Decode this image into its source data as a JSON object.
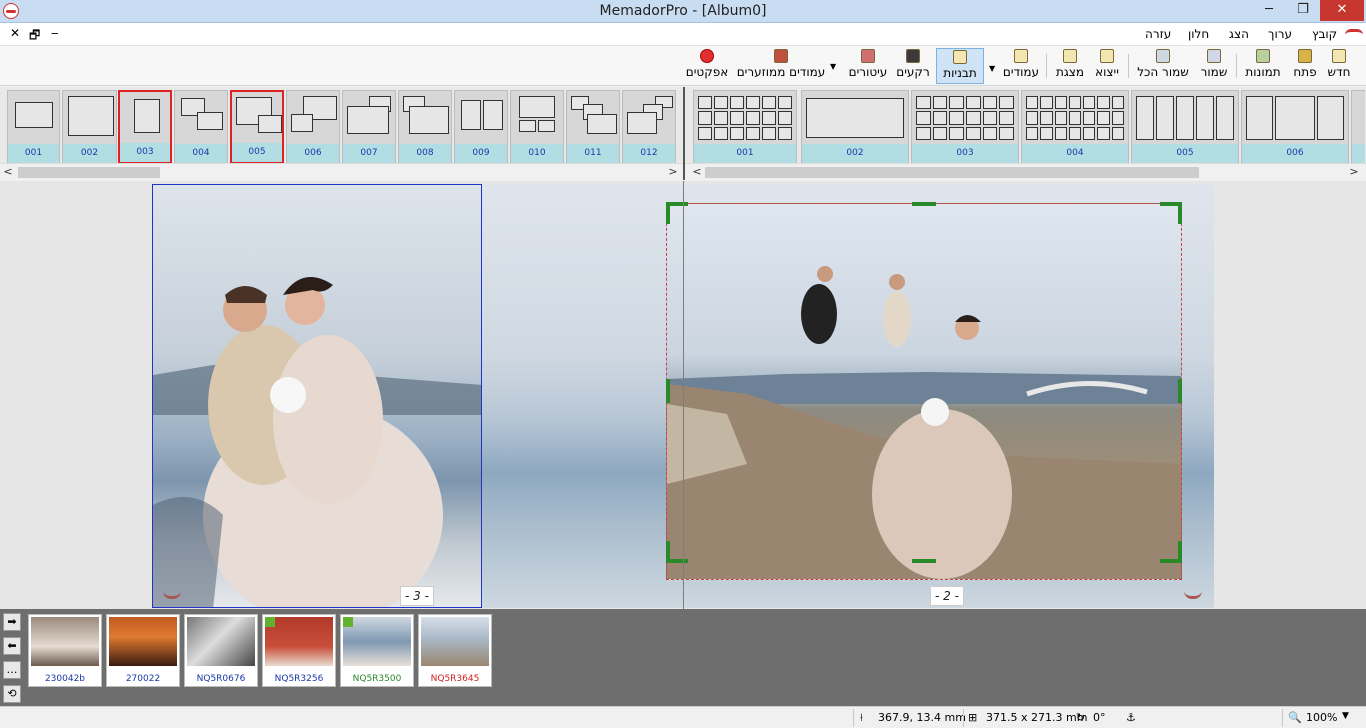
{
  "window": {
    "title": "MemadorPro - [Album0]",
    "minimize": "─",
    "maximize": "❐",
    "close": "✕"
  },
  "menu": {
    "items": [
      "קובץ",
      "ערוך",
      "הצג",
      "חלון",
      "עזרה"
    ],
    "mdi": {
      "close": "✕",
      "restore": "🗗",
      "minimize": "‒"
    }
  },
  "toolbar": {
    "new": "חדש",
    "open": "פתח",
    "photos": "תמונות",
    "save": "שמור",
    "save_all": "שמור הכל",
    "export": "ייצוא",
    "presentation": "מצגת",
    "pages": "עמודים",
    "templates": "תבניות",
    "backgrounds": "רקעים",
    "decorations": "עיטורים",
    "suggested_pages": "עמודים ממוזערים",
    "effects": "אפקטים"
  },
  "layouts": {
    "labels": [
      "001",
      "002",
      "003",
      "004",
      "005",
      "006",
      "007",
      "008",
      "009",
      "010",
      "011",
      "012"
    ],
    "selected": [
      "003",
      "005"
    ]
  },
  "backgrounds": {
    "labels": [
      "001",
      "002",
      "003",
      "004",
      "005",
      "006"
    ]
  },
  "spread": {
    "left_page_number": "- 3 -",
    "right_page_number": "- 2 -"
  },
  "thumbnails": [
    {
      "name": "230042b",
      "color": "#1a39a8",
      "badge": false
    },
    {
      "name": "270022",
      "color": "#1a39a8",
      "badge": false
    },
    {
      "name": "NQ5R0676",
      "color": "#1a39a8",
      "badge": false
    },
    {
      "name": "NQ5R3256",
      "color": "#1a39a8",
      "badge": true
    },
    {
      "name": "NQ5R3500",
      "color": "#2a8a2a",
      "badge": true
    },
    {
      "name": "NQ5R3645",
      "color": "#d22222",
      "badge": false
    }
  ],
  "side_buttons": [
    "➡",
    "⬅",
    "…",
    "⟲"
  ],
  "status": {
    "position": "367.9, 13.4 mm",
    "size": "371.5 x 271.3 mm",
    "rotation": "0°",
    "zoom": "100%"
  }
}
